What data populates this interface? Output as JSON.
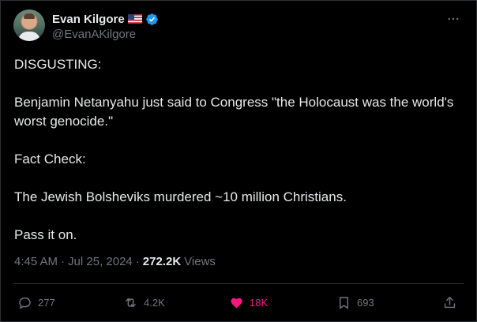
{
  "tweet": {
    "author": {
      "name": "Evan Kilgore",
      "handle": "@EvanAKilgore",
      "flag_icon": "us-flag-icon",
      "verified_icon": "verified-badge-icon"
    },
    "more_icon": "more-dots-icon",
    "paragraphs": [
      "DISGUSTING:",
      "Benjamin Netanyahu just said to Congress \"the Holocaust was the world's worst genocide.\"",
      "Fact Check:",
      "The Jewish Bolsheviks murdered ~10 million Christians.",
      "Pass it on."
    ],
    "time": "4:45 AM",
    "separator": "·",
    "date": "Jul 25, 2024",
    "views_count": "272.2K",
    "views_label": "Views"
  },
  "actions": {
    "reply": {
      "icon": "reply-icon",
      "count": "277"
    },
    "repost": {
      "icon": "repost-icon",
      "count": "4.2K"
    },
    "like": {
      "icon": "heart-filled-icon",
      "count": "18K",
      "color": "#f91880"
    },
    "bookmark": {
      "icon": "bookmark-icon",
      "count": "693"
    },
    "share": {
      "icon": "share-icon"
    }
  },
  "colors": {
    "background": "#000000",
    "text": "#e7e9ea",
    "muted": "#71767b",
    "border": "#2f3336",
    "verified": "#1d9bf0",
    "like": "#f91880"
  }
}
